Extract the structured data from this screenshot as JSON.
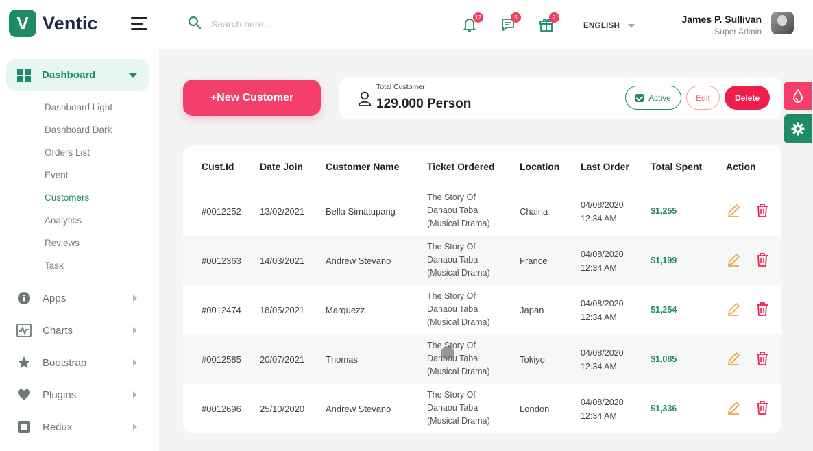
{
  "brand": {
    "logo_letter": "V",
    "name": "Ventic"
  },
  "sidebar": {
    "dashboard_label": "Dashboard",
    "submenu": [
      "Dashboard Light",
      "Dashboard Dark",
      "Orders List",
      "Event",
      "Customers",
      "Analytics",
      "Reviews",
      "Task"
    ],
    "active_submenu": "Customers",
    "items": [
      {
        "label": "Apps",
        "icon": "info-icon"
      },
      {
        "label": "Charts",
        "icon": "pulse-icon"
      },
      {
        "label": "Bootstrap",
        "icon": "star-icon"
      },
      {
        "label": "Plugins",
        "icon": "heart-icon"
      },
      {
        "label": "Redux",
        "icon": "square-icon"
      }
    ]
  },
  "header": {
    "search_placeholder": "Search here...",
    "notifications": {
      "count": "12",
      "icon": "bell-icon"
    },
    "messages": {
      "count": "5",
      "icon": "chat-icon"
    },
    "gifts": {
      "count": "2",
      "icon": "gift-icon"
    },
    "language": "ENGLISH",
    "user": {
      "name": "James P. Sullivan",
      "role": "Super Admin"
    }
  },
  "actions": {
    "new_customer": "+New Customer",
    "total_label": "Total Customer",
    "total_value": "129.000 Person",
    "active": "Active",
    "edit": "Edit",
    "delete": "Delete"
  },
  "table": {
    "headers": [
      "Cust.Id",
      "Date Join",
      "Customer Name",
      "Ticket Ordered",
      "Location",
      "Last Order",
      "Total Spent",
      "Action"
    ],
    "rows": [
      {
        "id": "#0012252",
        "date": "13/02/2021",
        "name": "Bella Simatupang",
        "ticket": [
          "The Story Of",
          "Danaou Taba",
          "(Musical Drama)"
        ],
        "location": "Chaina",
        "last_date": "04/08/2020",
        "last_time": "12:34 AM",
        "spent": "$1,255"
      },
      {
        "id": "#0012363",
        "date": "14/03/2021",
        "name": "Andrew Stevano",
        "ticket": [
          "The Story Of",
          "Danaou Taba",
          "(Musical Drama)"
        ],
        "location": "France",
        "last_date": "04/08/2020",
        "last_time": "12:34 AM",
        "spent": "$1,199"
      },
      {
        "id": "#0012474",
        "date": "18/05/2021",
        "name": "Marquezz",
        "ticket": [
          "The Story Of",
          "Danaou Taba",
          "(Musical Drama)"
        ],
        "location": "Japan",
        "last_date": "04/08/2020",
        "last_time": "12:34 AM",
        "spent": "$1,254"
      },
      {
        "id": "#0012585",
        "date": "20/07/2021",
        "name": "Thomas",
        "ticket": [
          "The Story Of",
          "Danaou Taba",
          "(Musical Drama)"
        ],
        "location": "Tokiyo",
        "last_date": "04/08/2020",
        "last_time": "12:34 AM",
        "spent": "$1,085"
      },
      {
        "id": "#0012696",
        "date": "25/10/2020",
        "name": "Andrew Stevano",
        "ticket": [
          "The Story Of",
          "Danaou Taba",
          "(Musical Drama)"
        ],
        "location": "London",
        "last_date": "04/08/2020",
        "last_time": "12:34 AM",
        "spent": "$1,336"
      }
    ]
  },
  "colors": {
    "brand": "#1e8a68",
    "accent": "#f43f6b",
    "danger": "#ef1d4b",
    "edit_icon": "#f0a347"
  }
}
